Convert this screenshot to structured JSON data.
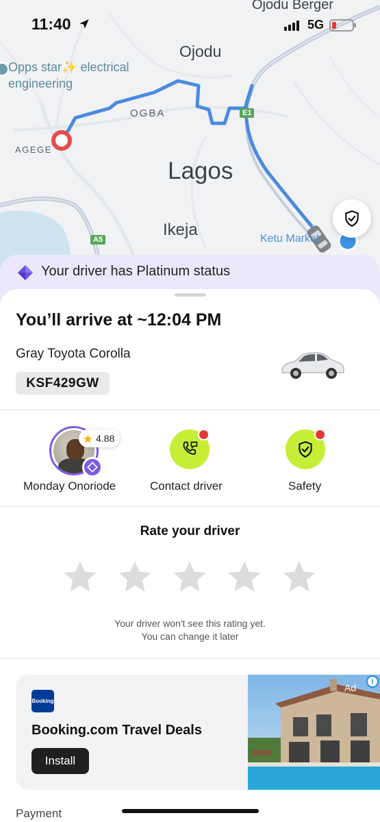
{
  "status_bar": {
    "time": "11:40",
    "network": "5G"
  },
  "map": {
    "labels": {
      "ojodu_berger": "Ojodu Berger",
      "ojodu": "Ojodu",
      "poi_line1": "Opps star✨ electrical",
      "poi_line2": "engineering",
      "ogba": "OGBA",
      "agege": "AGEGE",
      "lagos": "Lagos",
      "ikeja": "Ikeja",
      "ketu": "Ketu Market"
    },
    "road_badges": {
      "e1": "E1",
      "a5": "A5"
    },
    "route_color": "#4a8ae0"
  },
  "banner": {
    "text": "Your driver has Platinum status"
  },
  "trip": {
    "arrival": "You’ll arrive at ~12:04 PM",
    "car_model": "Gray Toyota Corolla",
    "plate": "KSF429GW"
  },
  "actions": {
    "driver_name": "Monday Onoriode",
    "driver_rating": "4.88",
    "contact_label": "Contact driver",
    "safety_label": "Safety"
  },
  "rating": {
    "title": "Rate your driver",
    "stars": 5,
    "selected": 0,
    "note_line1": "Your driver won't see this rating yet.",
    "note_line2": "You can change it later"
  },
  "ad": {
    "logo_text": "Booking",
    "title": "Booking.com Travel Deals",
    "install_label": "Install",
    "tag": "Ad",
    "info_icon": "i"
  },
  "footer": {
    "payment_label": "Payment"
  },
  "colors": {
    "platinum_bg": "#ece8fa",
    "accent_purple": "#7b5be6",
    "lime": "#c5ef36",
    "alert_red": "#e53935"
  }
}
